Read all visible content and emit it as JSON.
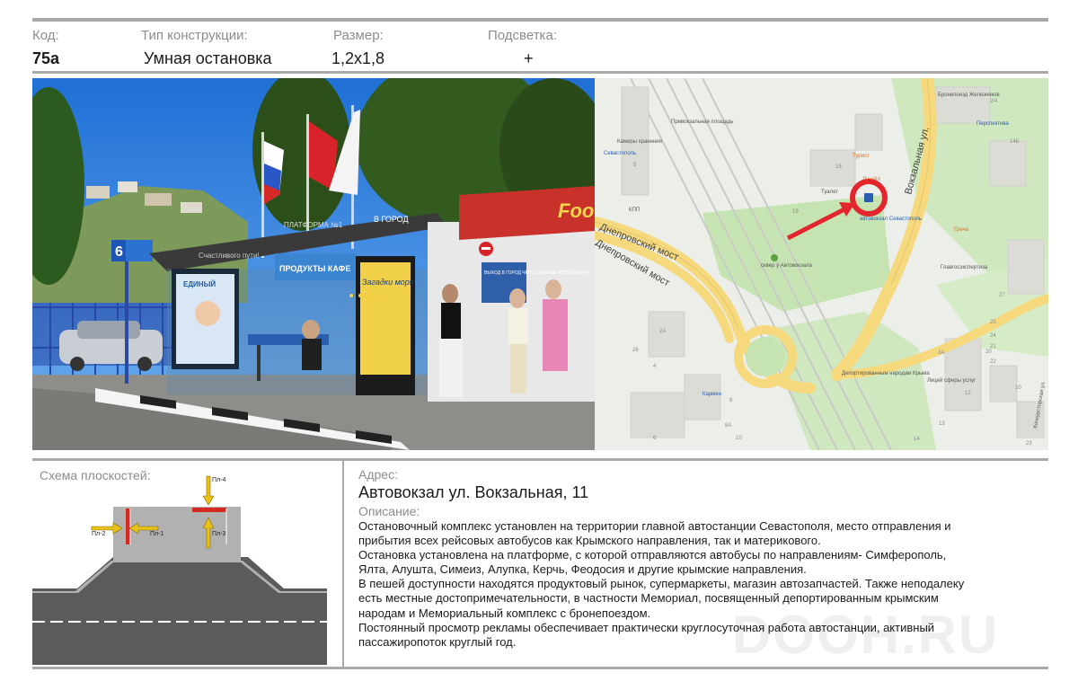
{
  "header": {
    "code_label": "Код:",
    "code_value": "75а",
    "type_label": "Тип конструкции:",
    "type_value": "Умная остановка",
    "size_label": "Размер:",
    "size_value": "1,2х1,8",
    "light_label": "Подсветка:",
    "light_value": "+"
  },
  "photo": {
    "stop_number": "6",
    "roof_sign_left": "ПЛАТФОРМА №1",
    "roof_sign_right": "В ГОРОД",
    "roof_sign_front": "Счастливого пути!",
    "kiosk_sign": "Food",
    "ad_left": "ЕДИНЫЙ",
    "ad_right": "Загадки моря",
    "kiosk_sign_2": "ПРОДУКТЫ КАФЕ",
    "exit_sign": "ВЫХОД В ГОРОД ЧЕРЕЗ ЗДАНИЕ АВТОВОКЗАЛА"
  },
  "map": {
    "labels": [
      "Привокзальная площадь",
      "Камеры хранения",
      "Севастополь",
      "Днепровский мост",
      "Днепровский мост",
      "Вокзальная ул.",
      "автовокзал Севастополь",
      "сквер у Автовокзала",
      "Турист",
      "Туалет",
      "Лукойл",
      "Перспектива",
      "Бронепоезд Железняков",
      "Греча",
      "Главгосэкспертиза",
      "Депортированным народам Крыма",
      "Лицей сферы услуг",
      "Кармен",
      "КПП",
      "Конкурсторская ул."
    ],
    "house_numbers": [
      "5",
      "15",
      "19",
      "2/4",
      "14Б",
      "2А",
      "4",
      "8",
      "6",
      "8А",
      "10",
      "27",
      "26",
      "3А",
      "20",
      "21",
      "22",
      "12",
      "13",
      "14",
      "25",
      "24",
      "10",
      "23"
    ]
  },
  "scheme": {
    "title": "Схема плоскостей:",
    "labels": [
      "Пл-1",
      "Пл-2",
      "Пл-3",
      "Пл-4"
    ],
    "colors": {
      "road": "#5b5b5b",
      "platform": "#b1b1b1",
      "panel": "#d32a21",
      "arrow": "#e8c21b"
    }
  },
  "address": {
    "label": "Адрес:",
    "value": "Автовокзал ул. Вокзальная, 11"
  },
  "description": {
    "label": "Описание:",
    "lines": [
      "Остановочный комплекс установлен на территории  главной автостанции Севастополя, место отправления и",
      "прибытия  всех рейсовых автобусов как Крымского направления, так и материкового.",
      " Остановка установлена на платформе, с которой отправляются автобусы по направлениям- Симферополь,",
      "Ялта, Алушта, Симеиз, Алупка, Керчь, Феодосия и другие крымские направления.",
      "В пешей доступности находятся продуктовый рынок, супермаркеты, магазин автозапчастей. Также неподалеку",
      "есть местные достопримечательности, в частности Мемориал, посвященный депортированным крымским",
      "народам и Мемориальный комплекс с бронепоездом.",
      "Постоянный  просмотр рекламы обеспечивает практически круглосуточная работа автостанции, активный",
      "пассажиропоток круглый год."
    ]
  },
  "watermark": "DOOH.RU"
}
